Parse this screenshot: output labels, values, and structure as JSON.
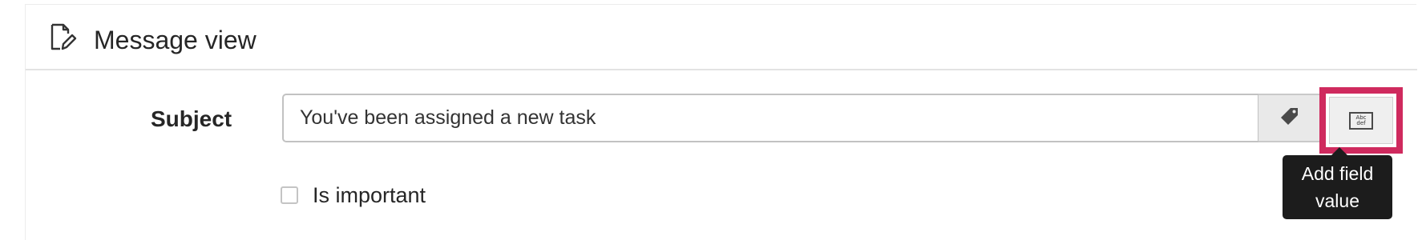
{
  "section": {
    "title": "Message view",
    "icon": "edit-document-icon"
  },
  "subject": {
    "label": "Subject",
    "value": "You've been assigned a new task"
  },
  "buttons": {
    "tag_icon": "tag-icon",
    "field_value_icon": "text-field-icon",
    "field_value_icon_text_line1": "Abc",
    "field_value_icon_text_line2": "def"
  },
  "tooltip": {
    "text": "Add field value"
  },
  "important": {
    "label": "Is important",
    "checked": false
  },
  "colors": {
    "highlight": "#cf2a5e",
    "tooltip_bg": "#1c1c1c"
  }
}
